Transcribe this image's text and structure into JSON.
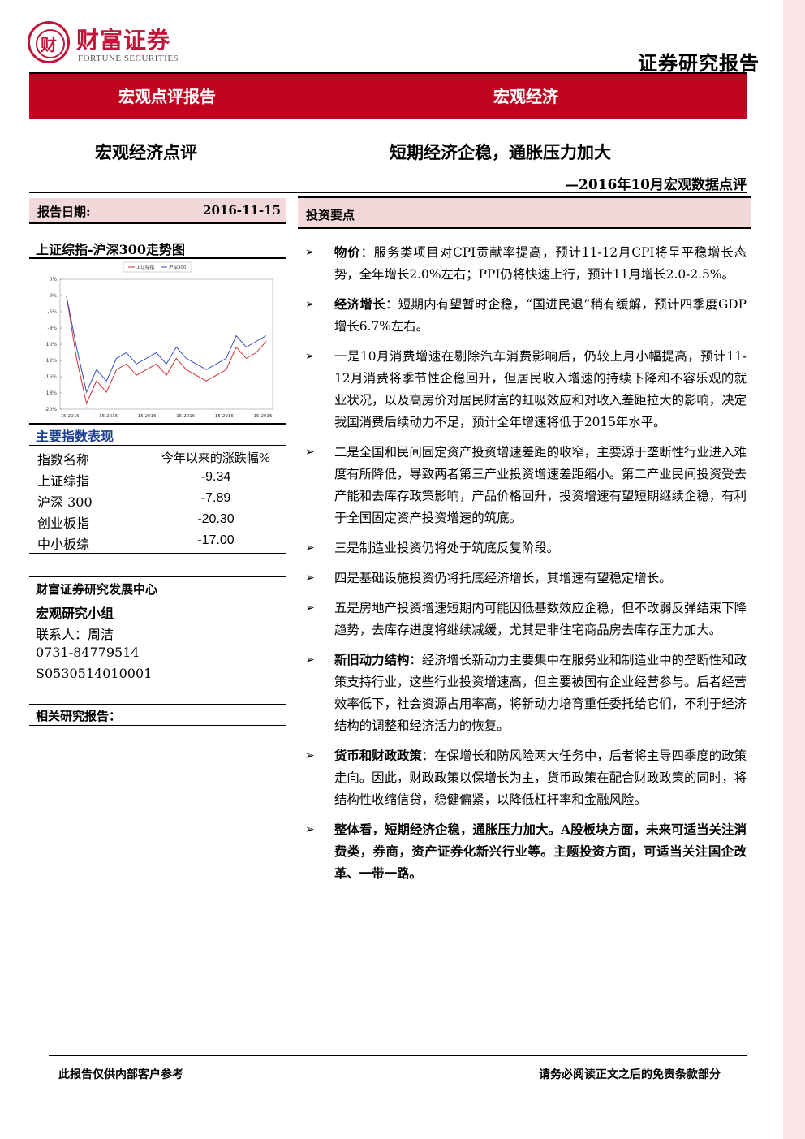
{
  "header": {
    "logo_glyph": "财",
    "logo_cn": "财富证券",
    "logo_en": "FORTUNE SECURITIES",
    "report_type": "证券研究报告"
  },
  "banner": {
    "left": "宏观点评报告",
    "right": "宏观经济"
  },
  "title": {
    "section": "宏观经济点评",
    "main": "短期经济企稳，通胀压力加大",
    "sub": "—2016年10月宏观数据点评"
  },
  "report_date": {
    "label": "报告日期:",
    "value": "2016-11-15"
  },
  "chart_title": "上证综指-沪深300走势图",
  "chart_data": {
    "type": "line",
    "series": [
      {
        "name": "上证综指",
        "color": "#d0303a",
        "values": [
          -1,
          -12,
          -20,
          -16,
          -18,
          -14,
          -13,
          -15,
          -14,
          -13,
          -15,
          -12,
          -14,
          -15,
          -16,
          -15,
          -14,
          -10,
          -12,
          -11,
          -9
        ]
      },
      {
        "name": "沪深300",
        "color": "#3b4fc2",
        "values": [
          -1,
          -10,
          -18,
          -14,
          -16,
          -12,
          -11,
          -13,
          -12,
          -11,
          -13,
          -10,
          -12,
          -13,
          -14,
          -13,
          -12,
          -8,
          -10,
          -9,
          -8
        ]
      }
    ],
    "y_ticks": [
      "0%",
      "-2%",
      "-5%",
      "-8%",
      "10%",
      "-12%",
      "-15%",
      "18%",
      "-20%"
    ],
    "x_ticks": [
      "15-2016",
      "15-2016",
      "15-2016",
      "15-2016",
      "15-2016",
      "15-2016"
    ],
    "ylim": [
      -21,
      2
    ]
  },
  "performance": {
    "title": "主要指数表现",
    "head": {
      "name": "指数名称",
      "value": "今年以来的涨跌幅%"
    },
    "rows": [
      {
        "name": "上证综指",
        "value": "-9.34"
      },
      {
        "name": "沪深 300",
        "value": "-7.89"
      },
      {
        "name": "创业板指",
        "value": "-20.30"
      },
      {
        "name": "中小板综",
        "value": "-17.00"
      }
    ]
  },
  "research": {
    "center": "财富证券研究发展中心",
    "group": "宏观研究小组",
    "contact": "联系人：周洁",
    "phone": "0731-84779514",
    "license": "S0530514010001",
    "related": "相关研究报告："
  },
  "investment": {
    "title": "投资要点",
    "arrow": "➢",
    "points": [
      {
        "lead": "物价",
        "text": "：服务类项目对CPI贡献率提高，预计11-12月CPI将呈平稳增长态势，全年增长2.0%左右；PPI仍将快速上行，预计11月增长2.0-2.5%。"
      },
      {
        "lead": "经济增长",
        "text": "：短期内有望暂时企稳，“国进民退”稍有缓解，预计四季度GDP增长6.7%左右。"
      },
      {
        "lead": "",
        "text": "一是10月消费增速在剔除汽车消费影响后，仍较上月小幅提高，预计11-12月消费将季节性企稳回升，但居民收入增速的持续下降和不容乐观的就业状况，以及高房价对居民财富的虹吸效应和对收入差距拉大的影响，决定我国消费后续动力不足，预计全年增速将低于2015年水平。"
      },
      {
        "lead": "",
        "text": "二是全国和民间固定资产投资增速差距的收窄，主要源于垄断性行业进入难度有所降低，导致两者第三产业投资增速差距缩小。第二产业民间投资受去产能和去库存政策影响，产品价格回升，投资增速有望短期继续企稳，有利于全国固定资产投资增速的筑底。"
      },
      {
        "lead": "",
        "text": "三是制造业投资仍将处于筑底反复阶段。"
      },
      {
        "lead": "",
        "text": "四是基础设施投资仍将托底经济增长，其增速有望稳定增长。"
      },
      {
        "lead": "",
        "text": "五是房地产投资增速短期内可能因低基数效应企稳，但不改弱反弹结束下降趋势，去库存进度将继续减缓，尤其是非住宅商品房去库存压力加大。"
      },
      {
        "lead": "新旧动力结构",
        "text": "：经济增长新动力主要集中在服务业和制造业中的垄断性和政策支持行业，这些行业投资增速高，但主要被国有企业经营参与。后者经营效率低下，社会资源占用率高，将新动力培育重任委托给它们，不利于经济结构的调整和经济活力的恢复。"
      },
      {
        "lead": "货币和财政政策",
        "text": "：在保增长和防风险两大任务中，后者将主导四季度的政策走向。因此，财政政策以保增长为主，货币政策在配合财政政策的同时，将结构性收缩信贷，稳健偏紧，以降低杠杆率和金融风险。"
      },
      {
        "lead": "",
        "text": "整体看，短期经济企稳，通胀压力加大。A股板块方面，未来可适当关注消费类，券商，资产证券化新兴行业等。主题投资方面，可适当关注国企改革、一带一路。",
        "all_bold": true
      }
    ]
  },
  "footer": {
    "left": "此报告仅供内部客户参考",
    "right": "请务必阅读正文之后的免责条款部分"
  }
}
